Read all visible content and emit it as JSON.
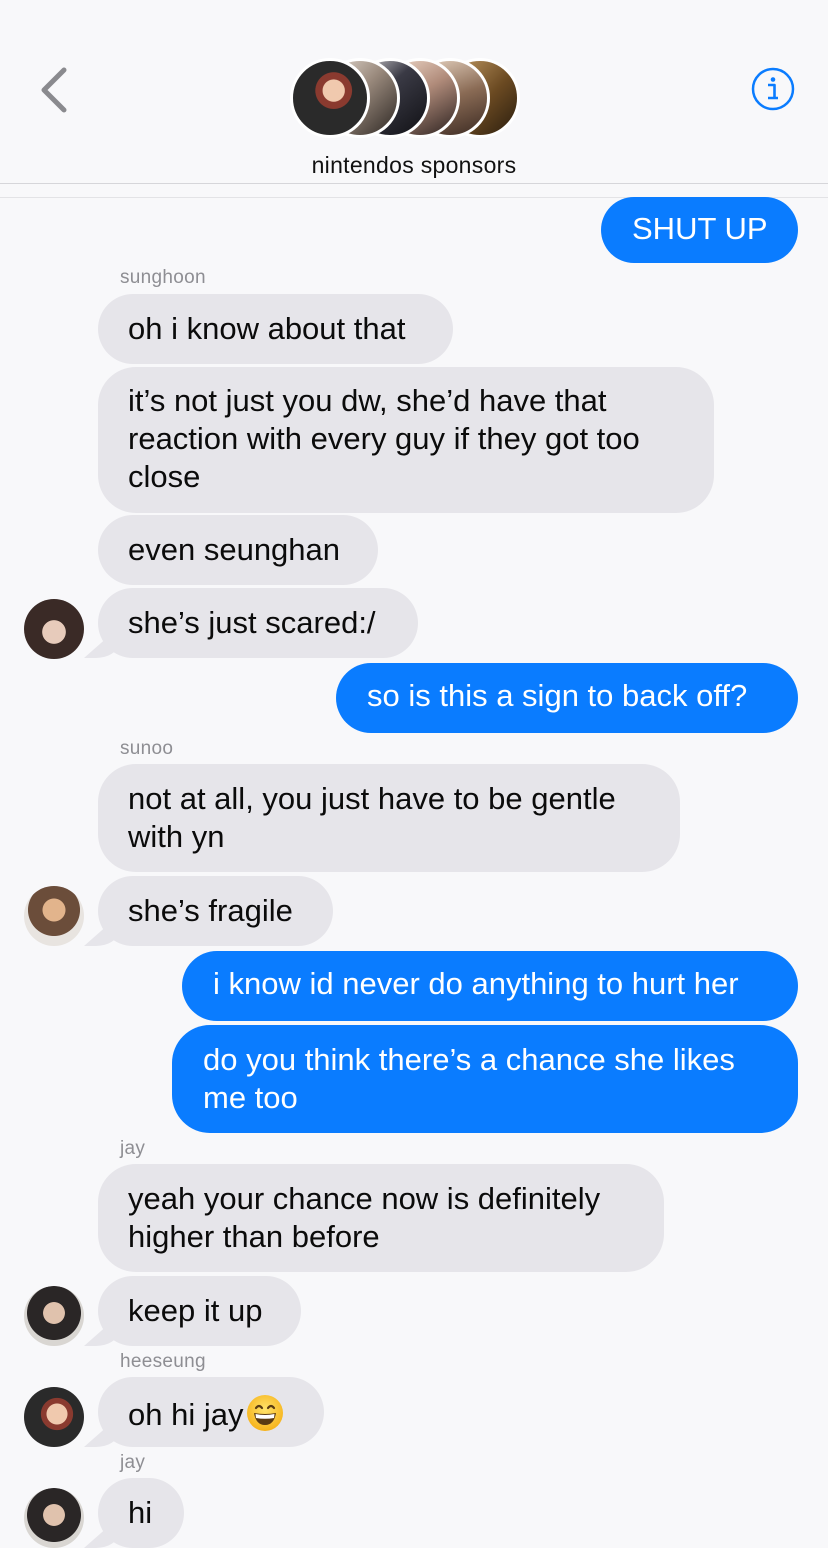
{
  "header": {
    "group_name": "nintendos sponsors",
    "back_icon": "chevron-left-icon",
    "info_icon": "info-icon",
    "accent": "#0a7cff"
  },
  "messages": [
    {
      "type": "out",
      "text": "SHUT UP"
    },
    {
      "type": "sender",
      "text": "sunghoon"
    },
    {
      "type": "in",
      "text": "oh i know about that"
    },
    {
      "type": "in",
      "lines": [
        "it’s not just you dw, she’d have that",
        "reaction with every guy if they got too",
        "close"
      ]
    },
    {
      "type": "in",
      "text": "even seunghan"
    },
    {
      "type": "in",
      "text": "she’s just scared:/"
    },
    {
      "type": "out",
      "text": "so is this a sign to back off?"
    },
    {
      "type": "sender",
      "text": "sunoo"
    },
    {
      "type": "in",
      "lines": [
        "not at all, you just have to be gentle",
        "with yn"
      ]
    },
    {
      "type": "in",
      "text": "she’s fragile"
    },
    {
      "type": "out",
      "text": "i know id never do anything to hurt her"
    },
    {
      "type": "out",
      "lines": [
        "do you think there’s a chance she likes",
        "me too"
      ]
    },
    {
      "type": "sender",
      "text": "jay"
    },
    {
      "type": "in",
      "lines": [
        "yeah your chance now is definitely",
        "higher than before"
      ]
    },
    {
      "type": "in",
      "text": "keep it up"
    },
    {
      "type": "sender",
      "text": "heeseung"
    },
    {
      "type": "in",
      "text": "oh hi jay",
      "emoji": "grinning-face-emoji"
    },
    {
      "type": "sender",
      "text": "jay"
    },
    {
      "type": "in",
      "text": "hi"
    }
  ]
}
